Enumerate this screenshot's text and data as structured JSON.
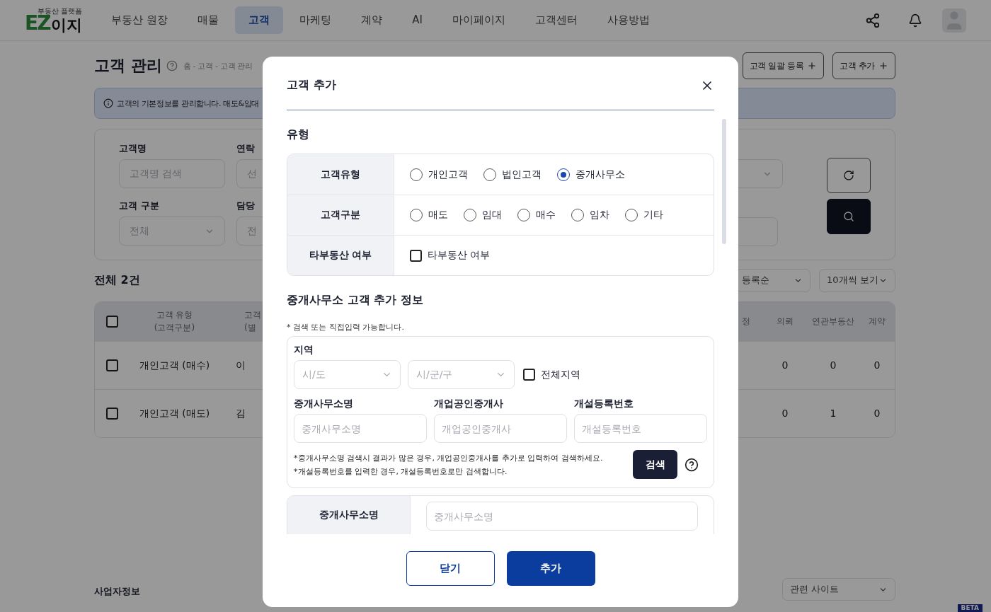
{
  "header": {
    "logo": {
      "mark": "EZ",
      "name": "이지",
      "tagline": "부동산 플랫폼"
    },
    "nav": [
      {
        "label": "부동산 원장",
        "selected": false
      },
      {
        "label": "매물",
        "selected": false
      },
      {
        "label": "고객",
        "selected": true
      },
      {
        "label": "마케팅",
        "selected": false
      },
      {
        "label": "계약",
        "selected": false
      },
      {
        "label": "AI",
        "selected": false
      },
      {
        "label": "마이페이지",
        "selected": false
      },
      {
        "label": "고객센터",
        "selected": false
      },
      {
        "label": "사용방법",
        "selected": false
      }
    ]
  },
  "page": {
    "title": "고객 관리",
    "breadcrumb": "홈 - 고객 - 고객 관리",
    "actions": [
      "고객 일괄 등록",
      "고객 추가"
    ],
    "notice": "고객의 기본정보를 관리합니다. 매도&임대"
  },
  "filters": {
    "fields": [
      {
        "label": "고객명",
        "kind": "input",
        "text": "고객명 검색"
      },
      {
        "label": "연락",
        "kind": "input",
        "text": "선"
      },
      {
        "label": "고객 구분",
        "kind": "select",
        "text": "전체"
      },
      {
        "label": "담당",
        "kind": "input",
        "text": "전"
      }
    ]
  },
  "list": {
    "total": "전체 2건",
    "sort": "등록순",
    "page_size": "10개씩 보기"
  },
  "table": {
    "header_checked": false,
    "left_columns": [
      {
        "label": "고객 유형",
        "sub": "(고객구분)"
      },
      {
        "label": "고객",
        "sub": "(별"
      }
    ],
    "right_columns": [
      "정",
      "의뢰",
      "연관부동산",
      "계약"
    ],
    "rows": [
      {
        "checked": false,
        "type": "개인고객 (매수)",
        "name": "이",
        "counts": [
          "0",
          "0",
          "0"
        ]
      },
      {
        "checked": false,
        "type": "개인고객 (매도)",
        "name": "김",
        "counts": [
          "0",
          "1",
          "0"
        ]
      }
    ]
  },
  "footer": {
    "title": "사업자정보",
    "related": "관련 사이트",
    "badge": "BETA"
  },
  "modal": {
    "title": "고객 추가",
    "type_section": {
      "heading": "유형",
      "rows": [
        {
          "kind": "radio",
          "label": "고객유형",
          "options": [
            {
              "label": "개인고객",
              "selected": false
            },
            {
              "label": "법인고객",
              "selected": false
            },
            {
              "label": "중개사무소",
              "selected": true
            }
          ]
        },
        {
          "kind": "radio",
          "label": "고객구분",
          "options": [
            {
              "label": "매도",
              "selected": false
            },
            {
              "label": "임대",
              "selected": false
            },
            {
              "label": "매수",
              "selected": false
            },
            {
              "label": "임차",
              "selected": false
            },
            {
              "label": "기타",
              "selected": false
            }
          ]
        },
        {
          "kind": "checkbox",
          "label": "타부동산 여부",
          "options": [
            {
              "label": "타부동산 여부",
              "checked": false
            }
          ]
        }
      ]
    },
    "broker_section": {
      "heading": "중개사무소 고객 추가 정보",
      "note": "* 검색 또는 직접입력 가능합니다.",
      "region": {
        "label": "지역",
        "selects": [
          "시/도",
          "시/군/구"
        ],
        "all": {
          "label": "전체지역",
          "checked": false
        }
      },
      "fields": [
        {
          "label": "중개사무소명",
          "placeholder": "중개사무소명"
        },
        {
          "label": "개업공인중개사",
          "placeholder": "개업공인중개사"
        },
        {
          "label": "개설등록번호",
          "placeholder": "개설등록번호"
        }
      ],
      "hints": [
        "*중개사무소명 검색시 결과가 많은 경우, 개업공인중개사를 추가로 입력하여 검색하세요.",
        "*개설등록번호를 입력한 경우, 개설등록번호로만 검색합니다."
      ],
      "search": "검색",
      "row": {
        "label": "중개사무소명",
        "placeholder": "중개사무소명"
      }
    },
    "buttons": [
      {
        "label": "닫기",
        "kind": "secondary"
      },
      {
        "label": "추가",
        "kind": "primary"
      }
    ]
  }
}
